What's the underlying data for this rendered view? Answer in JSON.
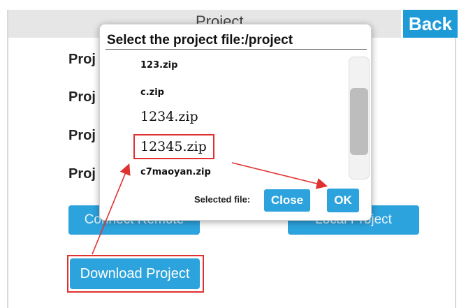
{
  "header": {
    "title": "Project",
    "back_label": "Back"
  },
  "main": {
    "project_labels": [
      "Proj",
      "Proj",
      "Proj",
      "Proj"
    ],
    "connect_remote_label": "Connect Remote",
    "local_project_label": "Local Project",
    "download_project_label": "Download Project"
  },
  "dialog": {
    "title": "Select the project file:/project",
    "files": [
      "123.zip",
      "c.zip",
      "1234.zip",
      "12345.zip",
      "c7maoyan.zip"
    ],
    "selected_file_label": "Selected file:",
    "close_label": "Close",
    "ok_label": "OK"
  },
  "annotations": {
    "highlight_color": "#e03131"
  },
  "colors": {
    "accent": "#2ca3dd",
    "back": "#1e9bd7",
    "title_bar": "#e6e6e6"
  }
}
